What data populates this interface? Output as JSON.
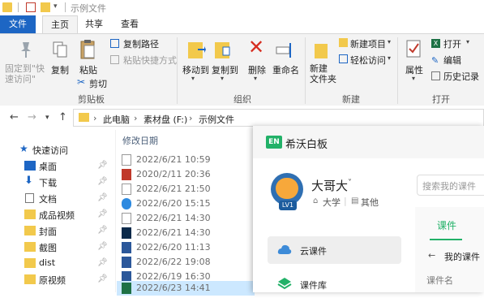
{
  "window": {
    "title": "示例文件"
  },
  "ribbon_tabs": [
    "文件",
    "主页",
    "共享",
    "查看"
  ],
  "ribbon": {
    "pin_label": "固定到\"快\n速访问\"",
    "copy_label": "复制",
    "paste_label": "粘贴",
    "copy_path_label": "复制路径",
    "paste_shortcut_label": "粘贴快捷方式",
    "cut_label": "剪切",
    "clipboard_group": "剪贴板",
    "move_to_label": "移动到",
    "copy_to_label": "复制到",
    "delete_label": "删除",
    "rename_label": "重命名",
    "organize_group": "组织",
    "new_folder_label": "新建\n文件夹",
    "new_item_label": "新建项目",
    "easy_access_label": "轻松访问",
    "new_group": "新建",
    "properties_label": "属性",
    "open_label": "打开",
    "edit_label": "编辑",
    "history_label": "历史记录",
    "open_group": "打开"
  },
  "address": {
    "crumbs": [
      "此电脑",
      "素材盘 (F:)",
      "示例文件"
    ]
  },
  "nav": {
    "quick_access": "快速访问",
    "items": [
      "桌面",
      "下载",
      "文档",
      "成品视频",
      "封面",
      "截图",
      "dist",
      "原视频"
    ]
  },
  "file_list": {
    "column_header": "修改日期",
    "dates": [
      "2022/6/21 10:59",
      "2020/2/11 20:36",
      "2022/6/21 21:50",
      "2022/6/20 15:15",
      "2022/6/21 14:30",
      "2022/6/21 14:30",
      "2022/6/20 11:13",
      "2022/6/22 19:08",
      "2022/6/19 16:30",
      "2022/6/23 14:41"
    ]
  },
  "overlay_app": {
    "logo_text": "EN",
    "name": "希沃白板",
    "user_name": "大哥大",
    "level": "LV1",
    "school": "大学",
    "extra": "其他",
    "search_placeholder": "搜索我的课件",
    "tab_label": "课件",
    "menu_cloud": "云课件",
    "menu_library": "课件库",
    "my_courseware": "我的课件",
    "course_name_label": "课件名"
  },
  "colors": {
    "accent": "#1d66c4",
    "app_green": "#22b168",
    "selection": "#cce8ff"
  }
}
